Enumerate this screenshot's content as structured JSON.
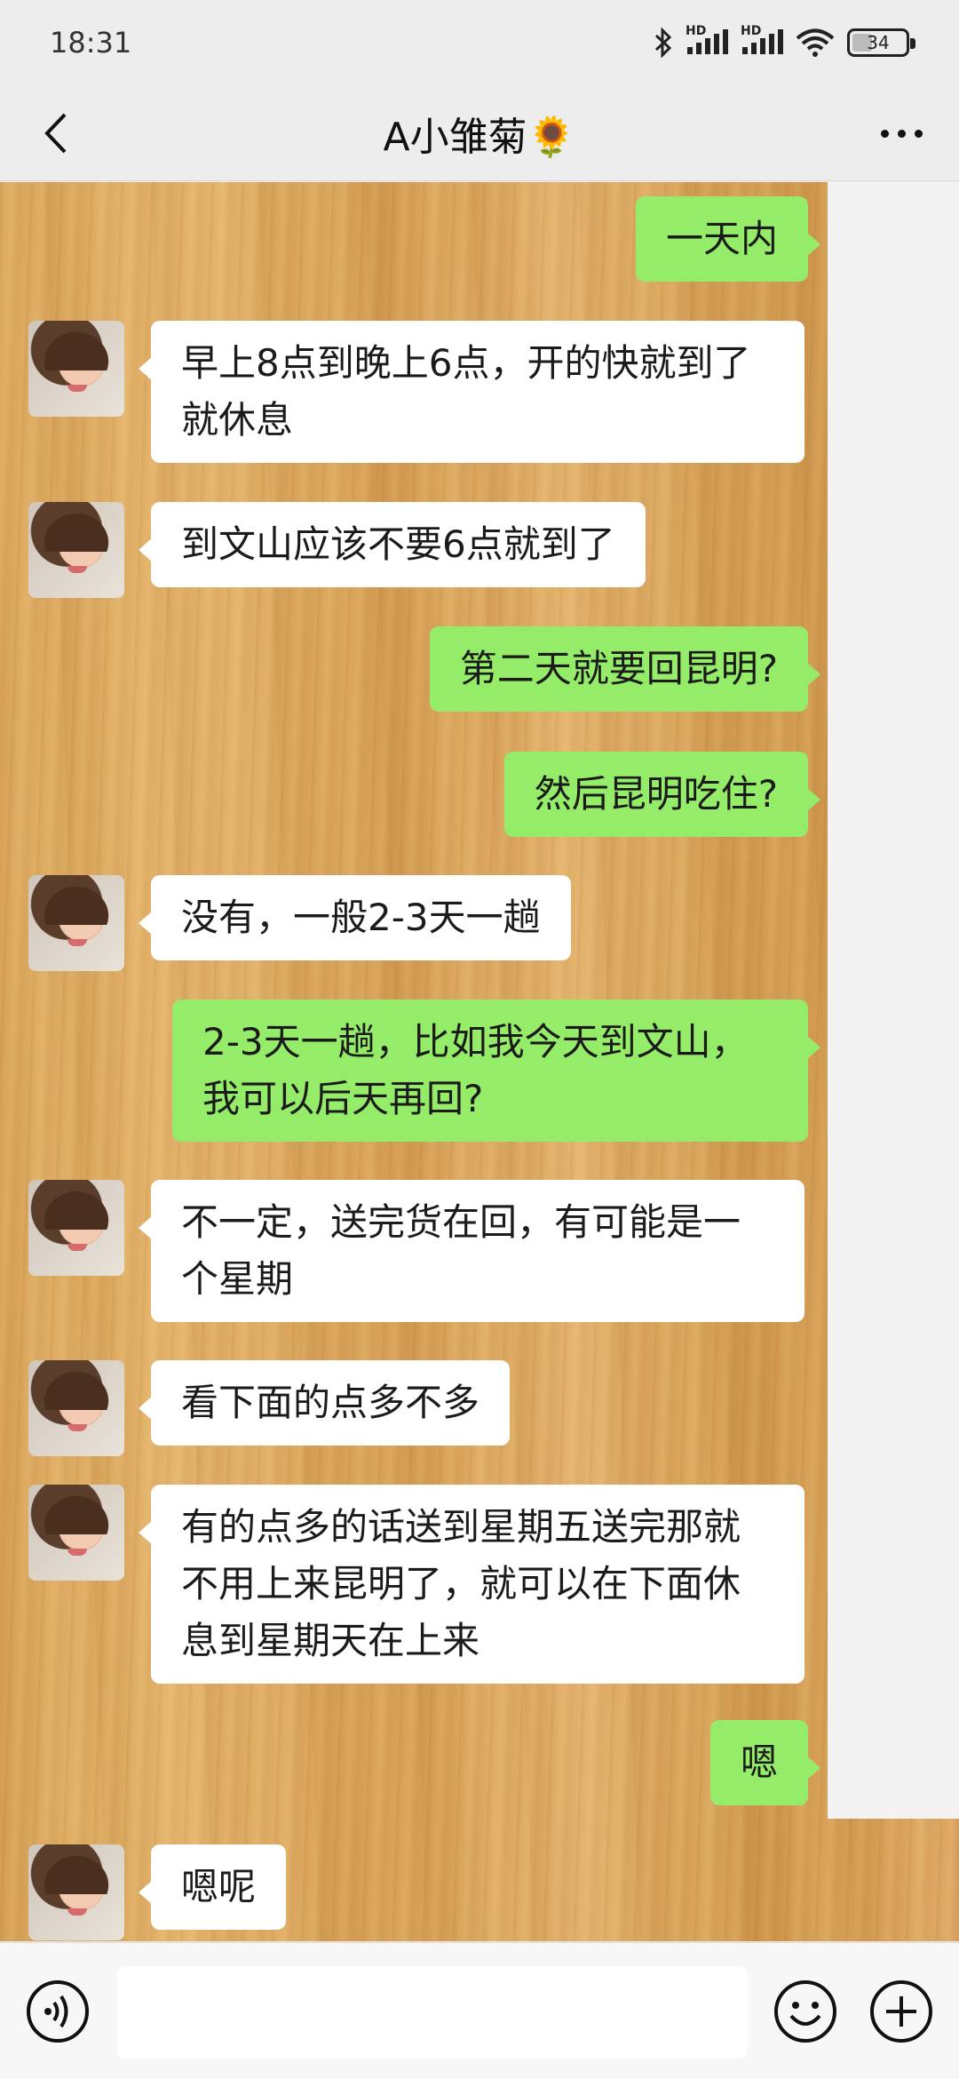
{
  "status_bar": {
    "time": "18:31",
    "hd_label_1": "HD",
    "hd_label_2": "HD",
    "battery": "34",
    "icons": [
      "bluetooth-icon",
      "signal-icon",
      "signal-icon",
      "wifi-icon",
      "battery-icon"
    ]
  },
  "header": {
    "title": "A小雏菊🌻"
  },
  "messages": [
    {
      "side": "right",
      "text": "一天内"
    },
    {
      "side": "left",
      "text": "早上8点到晚上6点，开的快就到了就休息"
    },
    {
      "side": "left",
      "text": "到文山应该不要6点就到了"
    },
    {
      "side": "right",
      "text": "第二天就要回昆明?"
    },
    {
      "side": "right",
      "text": "然后昆明吃住?"
    },
    {
      "side": "left",
      "text": "没有，一般2-3天一趟"
    },
    {
      "side": "right",
      "text": "2-3天一趟，比如我今天到文山，我可以后天再回?"
    },
    {
      "side": "left",
      "text": "不一定，送完货在回，有可能是一个星期"
    },
    {
      "side": "left",
      "text": "看下面的点多不多"
    },
    {
      "side": "left",
      "text": "有的点多的话送到星期五送完那就不用上来昆明了，就可以在下面休息到星期天在上来"
    },
    {
      "side": "right",
      "text": "嗯"
    },
    {
      "side": "left",
      "text": "嗯呢"
    }
  ],
  "input_bar": {
    "placeholder": "",
    "icons": [
      "voice-icon",
      "emoji-icon",
      "plus-icon"
    ]
  },
  "colors": {
    "sent_bubble": "#95ec69",
    "received_bubble": "#ffffff",
    "bar_background": "#ededed"
  }
}
